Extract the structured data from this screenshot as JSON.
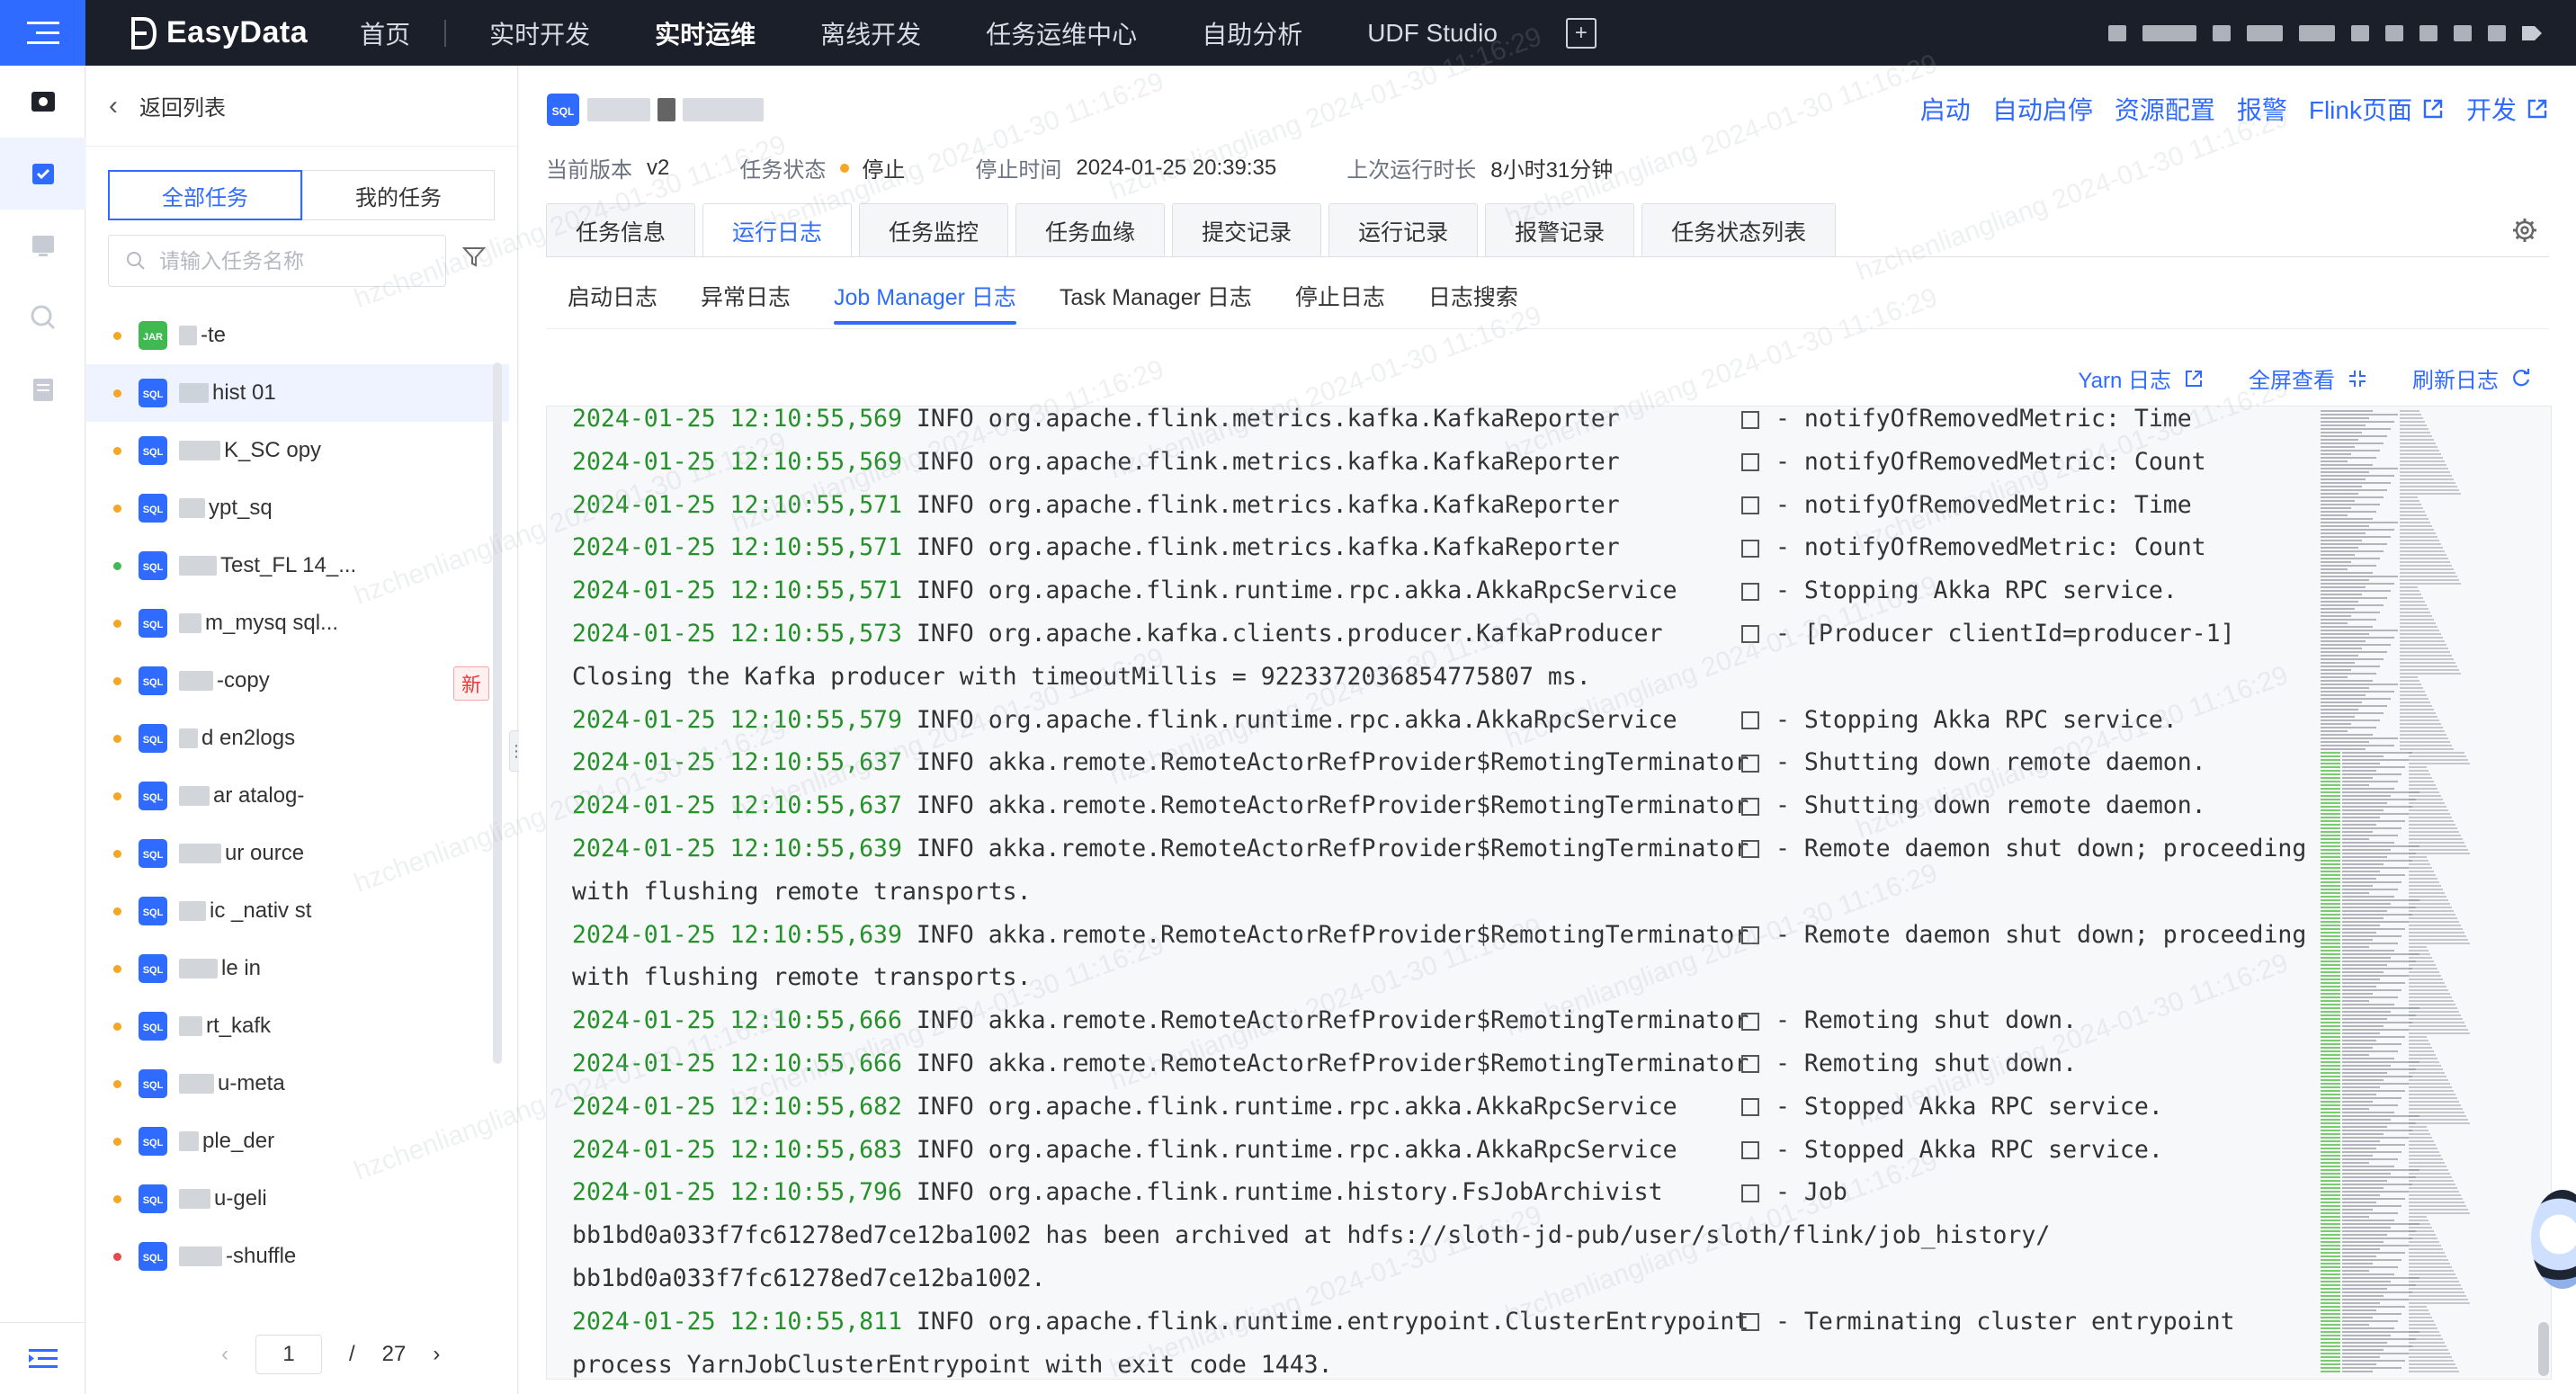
{
  "topnav": {
    "logo": "EasyData",
    "items": [
      {
        "label": "首页"
      },
      {
        "label": "实时开发"
      },
      {
        "label": "实时运维"
      },
      {
        "label": "离线开发"
      },
      {
        "label": "任务运维中心"
      },
      {
        "label": "自助分析"
      },
      {
        "label": "UDF Studio"
      }
    ],
    "active": "实时运维"
  },
  "taskpanel": {
    "back_label": "返回列表",
    "tab_all": "全部任务",
    "tab_mine": "我的任务",
    "search_placeholder": "请输入任务名称",
    "tasks": [
      {
        "badge": "JAR",
        "text": "-te",
        "status": "#f5a623"
      },
      {
        "badge": "SQL",
        "text": "hist   01",
        "status": "#f5a623"
      },
      {
        "badge": "SQL",
        "text": "K_SC   opy",
        "status": "#f5a623"
      },
      {
        "badge": "SQL",
        "text": "ypt_sq",
        "status": "#f5a623"
      },
      {
        "badge": "SQL",
        "text": "Test_FL   14_...",
        "status": "#3fb950"
      },
      {
        "badge": "SQL",
        "text": "m_mysq   sql...",
        "status": "#f5a623"
      },
      {
        "badge": "SQL",
        "text": "-copy",
        "status": "#f5a623",
        "tag": "新"
      },
      {
        "badge": "SQL",
        "text": "d   en2logs",
        "status": "#f5a623"
      },
      {
        "badge": "SQL",
        "text": "ar   atalog-",
        "status": "#f5a623"
      },
      {
        "badge": "SQL",
        "text": "ur   ource",
        "status": "#f5a623"
      },
      {
        "badge": "SQL",
        "text": "ic   _nativ   st",
        "status": "#f5a623"
      },
      {
        "badge": "SQL",
        "text": "le   in",
        "status": "#f5a623"
      },
      {
        "badge": "SQL",
        "text": "rt_kafk",
        "status": "#f5a623"
      },
      {
        "badge": "SQL",
        "text": "u-meta",
        "status": "#f5a623"
      },
      {
        "badge": "SQL",
        "text": "ple_der",
        "status": "#f5a623"
      },
      {
        "badge": "SQL",
        "text": "u-geli",
        "status": "#f5a623"
      },
      {
        "badge": "SQL",
        "text": "-shuffle",
        "status": "#e5484d"
      }
    ],
    "pager": {
      "current": "1",
      "sep": "/",
      "total": "27"
    }
  },
  "task": {
    "version_label": "当前版本",
    "version": "v2",
    "status_label": "任务状态",
    "status": "停止",
    "stop_time_label": "停止时间",
    "stop_time": "2024-01-25 20:39:35",
    "last_run_label": "上次运行时长",
    "last_run": "8小时31分钟"
  },
  "actions": {
    "start": "启动",
    "auto_restart": "自动启停",
    "resources": "资源配置",
    "alarm": "报警",
    "flink_page": "Flink页面",
    "develop": "开发"
  },
  "tabs": [
    "任务信息",
    "运行日志",
    "任务监控",
    "任务血缘",
    "提交记录",
    "运行记录",
    "报警记录",
    "任务状态列表"
  ],
  "active_tab": "运行日志",
  "subtabs": [
    "启动日志",
    "异常日志",
    "Job Manager 日志",
    "Task Manager 日志",
    "停止日志",
    "日志搜索"
  ],
  "active_subtab": "Job Manager 日志",
  "log_tools": {
    "yarn": "Yarn 日志",
    "fullscreen": "全屏查看",
    "refresh": "刷新日志"
  },
  "watermark": "hzchenliangliang 2024-01-30 11:16:29",
  "log_lines": [
    {
      "ts": "2024-01-25 12:10:55,569",
      "level": "INFO",
      "cls": "org.apache.flink.metrics.kafka.KafkaReporter",
      "msg": "- notifyOfRemovedMetric: Time"
    },
    {
      "ts": "2024-01-25 12:10:55,569",
      "level": "INFO",
      "cls": "org.apache.flink.metrics.kafka.KafkaReporter",
      "msg": "- notifyOfRemovedMetric: Count"
    },
    {
      "ts": "2024-01-25 12:10:55,571",
      "level": "INFO",
      "cls": "org.apache.flink.metrics.kafka.KafkaReporter",
      "msg": "- notifyOfRemovedMetric: Time"
    },
    {
      "ts": "2024-01-25 12:10:55,571",
      "level": "INFO",
      "cls": "org.apache.flink.metrics.kafka.KafkaReporter",
      "msg": "- notifyOfRemovedMetric: Count"
    },
    {
      "ts": "2024-01-25 12:10:55,571",
      "level": "INFO",
      "cls": "org.apache.flink.runtime.rpc.akka.AkkaRpcService",
      "msg": "- Stopping Akka RPC service."
    },
    {
      "ts": "2024-01-25 12:10:55,573",
      "level": "INFO",
      "cls": "org.apache.kafka.clients.producer.KafkaProducer",
      "msg": "- [Producer clientId=producer-1]"
    },
    {
      "plain": "Closing the Kafka producer with timeoutMillis = 9223372036854775807 ms."
    },
    {
      "ts": "2024-01-25 12:10:55,579",
      "level": "INFO",
      "cls": "org.apache.flink.runtime.rpc.akka.AkkaRpcService",
      "msg": "- Stopping Akka RPC service."
    },
    {
      "ts": "2024-01-25 12:10:55,637",
      "level": "INFO",
      "cls": "akka.remote.RemoteActorRefProvider$RemotingTerminator",
      "msg": "- Shutting down remote daemon."
    },
    {
      "ts": "2024-01-25 12:10:55,637",
      "level": "INFO",
      "cls": "akka.remote.RemoteActorRefProvider$RemotingTerminator",
      "msg": "- Shutting down remote daemon."
    },
    {
      "ts": "2024-01-25 12:10:55,639",
      "level": "INFO",
      "cls": "akka.remote.RemoteActorRefProvider$RemotingTerminator",
      "msg": "- Remote daemon shut down; proceeding"
    },
    {
      "plain": "with flushing remote transports."
    },
    {
      "ts": "2024-01-25 12:10:55,639",
      "level": "INFO",
      "cls": "akka.remote.RemoteActorRefProvider$RemotingTerminator",
      "msg": "- Remote daemon shut down; proceeding"
    },
    {
      "plain": "with flushing remote transports."
    },
    {
      "ts": "2024-01-25 12:10:55,666",
      "level": "INFO",
      "cls": "akka.remote.RemoteActorRefProvider$RemotingTerminator",
      "msg": "- Remoting shut down."
    },
    {
      "ts": "2024-01-25 12:10:55,666",
      "level": "INFO",
      "cls": "akka.remote.RemoteActorRefProvider$RemotingTerminator",
      "msg": "- Remoting shut down."
    },
    {
      "ts": "2024-01-25 12:10:55,682",
      "level": "INFO",
      "cls": "org.apache.flink.runtime.rpc.akka.AkkaRpcService",
      "msg": "- Stopped Akka RPC service."
    },
    {
      "ts": "2024-01-25 12:10:55,683",
      "level": "INFO",
      "cls": "org.apache.flink.runtime.rpc.akka.AkkaRpcService",
      "msg": "- Stopped Akka RPC service."
    },
    {
      "ts": "2024-01-25 12:10:55,796",
      "level": "INFO",
      "cls": "org.apache.flink.runtime.history.FsJobArchivist",
      "msg": "- Job"
    },
    {
      "plain": "bb1bd0a033f7fc61278ed7ce12ba1002 has been archived at hdfs://sloth-jd-pub/user/sloth/flink/job_history/"
    },
    {
      "plain": "bb1bd0a033f7fc61278ed7ce12ba1002."
    },
    {
      "ts": "2024-01-25 12:10:55,811",
      "level": "INFO",
      "cls": "org.apache.flink.runtime.entrypoint.ClusterEntrypoint",
      "msg": "- Terminating cluster entrypoint"
    },
    {
      "plain": "process YarnJobClusterEntrypoint with exit code 1443."
    }
  ],
  "colors": {
    "accent": "#2f6bff",
    "topbar": "#1b1f29",
    "timestamp": "#26912b",
    "stopped": "#f5a623"
  }
}
